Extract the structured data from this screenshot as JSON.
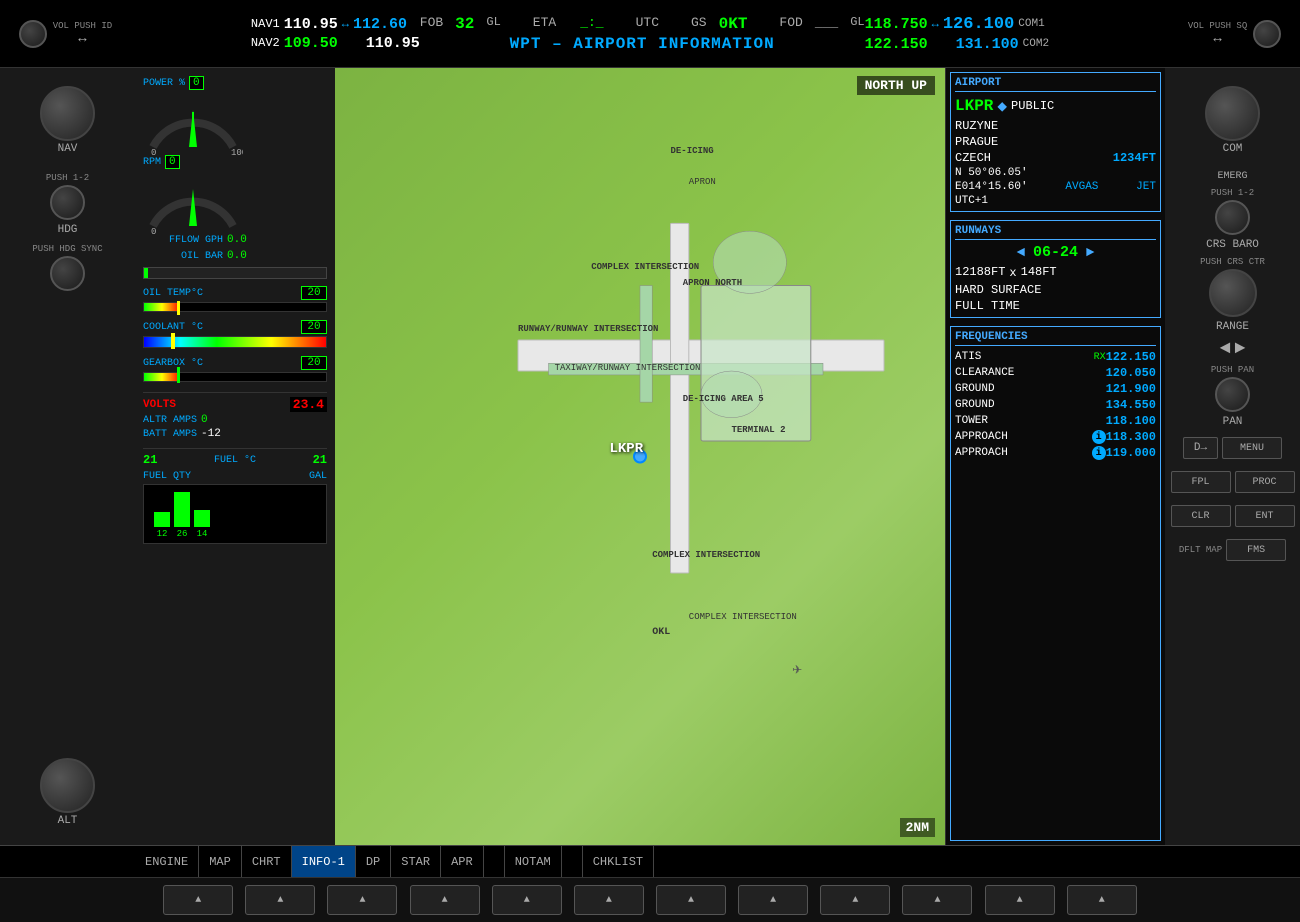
{
  "header": {
    "nav1_label": "NAV1",
    "nav1_active": "110.95",
    "nav1_arrow": "↔",
    "nav1_standby": "112.60",
    "nav2_label": "NAV2",
    "nav2_active": "109.50",
    "nav2_standby": "110.95",
    "fob_label": "FOB",
    "fob_val": "32",
    "fob_unit": "GL",
    "eta_label": "ETA",
    "eta_val": "_:_",
    "utc_label": "UTC",
    "gs_label": "GS",
    "gs_val": "0KT",
    "fod_label": "FOD",
    "fod_val": "___",
    "fod_unit": "GL",
    "wpt_title": "WPT – AIRPORT INFORMATION",
    "com_active1": "118.750",
    "com_arrow": "↔",
    "com_standby1": "126.100",
    "com_label1": "COM1",
    "com_active2": "122.150",
    "com_standby2": "131.100",
    "com_label2": "COM2"
  },
  "map": {
    "north_up": "NORTH UP",
    "scale": "2NM",
    "airport_id": "LKPR"
  },
  "engine": {
    "power_label": "POWER %",
    "power_val": "0",
    "rpm_label": "RPM",
    "rpm_val": "0",
    "fflow_label": "FFLOW GPH",
    "fflow_val": "0.0",
    "oil_bar_label": "OIL BAR",
    "oil_bar_val": "0.0",
    "oil_temp_label": "OIL TEMP°C",
    "oil_temp_val": "20",
    "coolant_label": "COOLANT °C",
    "coolant_val": "20",
    "gearbox_label": "GEARBOX °C",
    "gearbox_val": "20",
    "volts_label": "VOLTS",
    "volts_val": "23.4",
    "altr_label": "ALTR AMPS",
    "altr_val": "0",
    "batt_label": "BATT AMPS",
    "batt_val": "-12",
    "fuel_temp_left": "21",
    "fuel_temp_label": "FUEL °C",
    "fuel_temp_right": "21",
    "fuel_qty_label": "FUEL QTY",
    "fuel_gal_label": "GAL",
    "fuel_bar1_val": "12",
    "fuel_bar2_val": "26",
    "fuel_bar3_val": "14"
  },
  "airport_info": {
    "section_title": "AIRPORT",
    "id": "LKPR",
    "type": "PUBLIC",
    "name": "RUZYNE",
    "city": "PRAGUE",
    "country": "CZECH",
    "elevation": "1234FT",
    "lat": "N 50°06.05'",
    "lon": "E014°15.60'",
    "fuel1": "AVGAS",
    "fuel2": "JET",
    "utc": "UTC+1"
  },
  "runways": {
    "section_title": "RUNWAYS",
    "id": "06-24",
    "length": "12188FT",
    "width": "148FT",
    "surface": "HARD SURFACE",
    "hours": "FULL TIME"
  },
  "frequencies": {
    "section_title": "FREQUENCIES",
    "items": [
      {
        "name": "ATIS",
        "rx": "RX",
        "freq": "122.150"
      },
      {
        "name": "CLEARANCE",
        "rx": "",
        "freq": "120.050"
      },
      {
        "name": "GROUND",
        "rx": "",
        "freq": "121.900"
      },
      {
        "name": "GROUND",
        "rx": "",
        "freq": "134.550"
      },
      {
        "name": "TOWER",
        "rx": "",
        "freq": "118.100"
      },
      {
        "name": "APPROACH",
        "rx": "",
        "freq": "118.300",
        "info": true
      },
      {
        "name": "APPROACH",
        "rx": "",
        "freq": "119.000",
        "info": true
      }
    ]
  },
  "tabs": [
    {
      "label": "ENGINE",
      "active": false
    },
    {
      "label": "MAP",
      "active": false
    },
    {
      "label": "CHRT",
      "active": false
    },
    {
      "label": "INFO-1",
      "active": true
    },
    {
      "label": "DP",
      "active": false
    },
    {
      "label": "STAR",
      "active": false
    },
    {
      "label": "APR",
      "active": false
    },
    {
      "label": "",
      "active": false
    },
    {
      "label": "NOTAM",
      "active": false
    },
    {
      "label": "",
      "active": false
    },
    {
      "label": "CHKLIST",
      "active": false
    }
  ],
  "left_controls": {
    "vol_push": "VOL PUSH ID",
    "nav_label": "NAV",
    "push_12": "PUSH 1-2",
    "hdg_label": "HDG",
    "push_hdg_sync": "PUSH HDG SYNC",
    "alt_label": "ALT"
  },
  "right_controls": {
    "vol_push": "VOL PUSH SQ",
    "com_label": "COM",
    "emerg_label": "EMERG",
    "push_12": "PUSH 1-2",
    "crs_baro": "CRS BARO",
    "range_label": "RANGE",
    "push_crs_ctr": "PUSH CRS CTR",
    "push_pan": "PUSH PAN",
    "menu_label": "MENU",
    "fpl_label": "FPL",
    "proc_label": "PROC",
    "clr_label": "CLR",
    "ent_label": "ENT",
    "dflt_map": "DFLT MAP",
    "fms_label": "FMS"
  }
}
